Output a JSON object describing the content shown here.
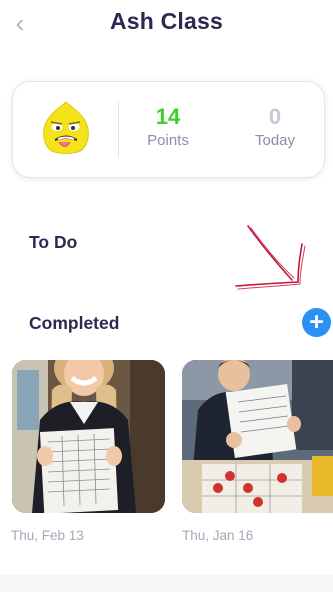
{
  "header": {
    "title": "Ash Class",
    "back_icon": "chevron-left-icon"
  },
  "summary": {
    "avatar": "yellow-monster-avatar",
    "points_value": "14",
    "points_label": "Points",
    "today_value": "0",
    "today_label": "Today"
  },
  "sections": {
    "todo_label": "To Do",
    "completed_label": "Completed",
    "add_icon": "plus-icon"
  },
  "completed_items": [
    {
      "date": "Thu, Feb 13"
    },
    {
      "date": "Thu, Jan 16"
    }
  ],
  "colors": {
    "title": "#2c2a50",
    "points": "#3fcf2a",
    "today": "#c9c6d7",
    "add_button": "#2c8ff4",
    "annotation_arrow": "#c2183f"
  }
}
